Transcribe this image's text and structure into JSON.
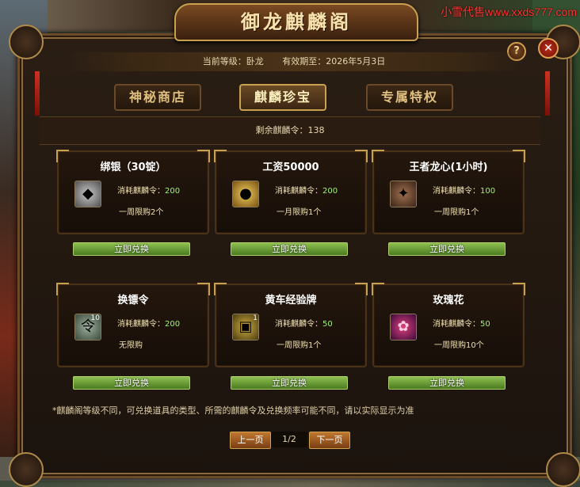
{
  "watermark": "小雪代售www.xxds777.com",
  "window": {
    "title": "御龙麒麟阁"
  },
  "header": {
    "level_label": "当前等级：卧龙",
    "expiry_label": "有效期至：2026年5月3日",
    "help": "?",
    "close": "✕"
  },
  "tabs": [
    {
      "label": "神秘商店",
      "active": false
    },
    {
      "label": "麒麟珍宝",
      "active": true
    },
    {
      "label": "专属特权",
      "active": false
    }
  ],
  "remain": {
    "text": "剩余麒麟令：138"
  },
  "items": [
    {
      "name": "绑银（30锭）",
      "cost_label": "消耗麒麟令：",
      "cost": "200",
      "limit": "一周限购2个",
      "button": "立即兑换",
      "icon": "silver-ingot-icon",
      "qty": ""
    },
    {
      "name": "工资50000",
      "cost_label": "消耗麒麟令：",
      "cost": "200",
      "limit": "一月限购1个",
      "button": "立即兑换",
      "icon": "gold-coin-icon",
      "qty": ""
    },
    {
      "name": "王者龙心(1小时)",
      "cost_label": "消耗麒麟令：",
      "cost": "100",
      "limit": "一周限购1个",
      "button": "立即兑换",
      "icon": "dragon-heart-icon",
      "qty": ""
    },
    {
      "name": "换镖令",
      "cost_label": "消耗麒麟令：",
      "cost": "200",
      "limit": "无限购",
      "button": "立即兑换",
      "icon": "escort-token-icon",
      "qty": "10"
    },
    {
      "name": "黄车经验牌",
      "cost_label": "消耗麒麟令：",
      "cost": "50",
      "limit": "一周限购1个",
      "button": "立即兑换",
      "icon": "cart-exp-icon",
      "qty": "1"
    },
    {
      "name": "玫瑰花",
      "cost_label": "消耗麒麟令：",
      "cost": "50",
      "limit": "一周限购10个",
      "button": "立即兑换",
      "icon": "rose-icon",
      "qty": ""
    }
  ],
  "note": "*麒麟阁等级不同，可兑换道具的类型、所需的麒麟令及兑换频率可能不同，请以实际显示为准",
  "pager": {
    "prev": "上一页",
    "page": "1/2",
    "next": "下一页"
  }
}
